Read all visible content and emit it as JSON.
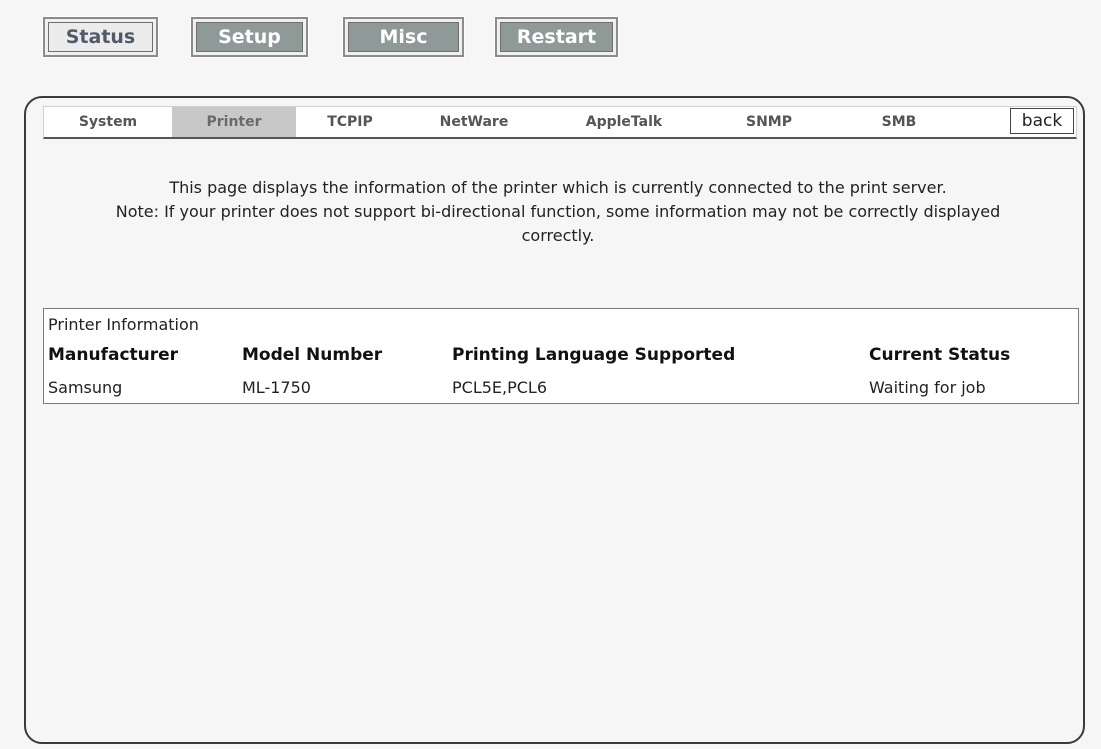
{
  "top_nav": {
    "status": "Status",
    "setup": "Setup",
    "misc": "Misc",
    "restart": "Restart"
  },
  "tabs": {
    "system": "System",
    "printer": "Printer",
    "tcpip": "TCPIP",
    "netware": "NetWare",
    "appletalk": "AppleTalk",
    "snmp": "SNMP",
    "smb": "SMB",
    "back": "back",
    "active": "Printer"
  },
  "description": {
    "line1": "This page displays the information of the printer which is currently connected to the print server.",
    "line2": "Note: If your printer does not support bi-directional function, some information may not be correctly displayed correctly."
  },
  "printer_info": {
    "title": "Printer Information",
    "headers": [
      "Manufacturer",
      "Model Number",
      "Printing Language Supported",
      "Current Status"
    ],
    "row": [
      "Samsung",
      "ML-1750",
      "PCL5E,PCL6",
      "Waiting for job"
    ]
  },
  "colors": {
    "background": "#f6f6f6",
    "dark_button": "#8f9a98",
    "active_tab": "#c8c8c8"
  }
}
